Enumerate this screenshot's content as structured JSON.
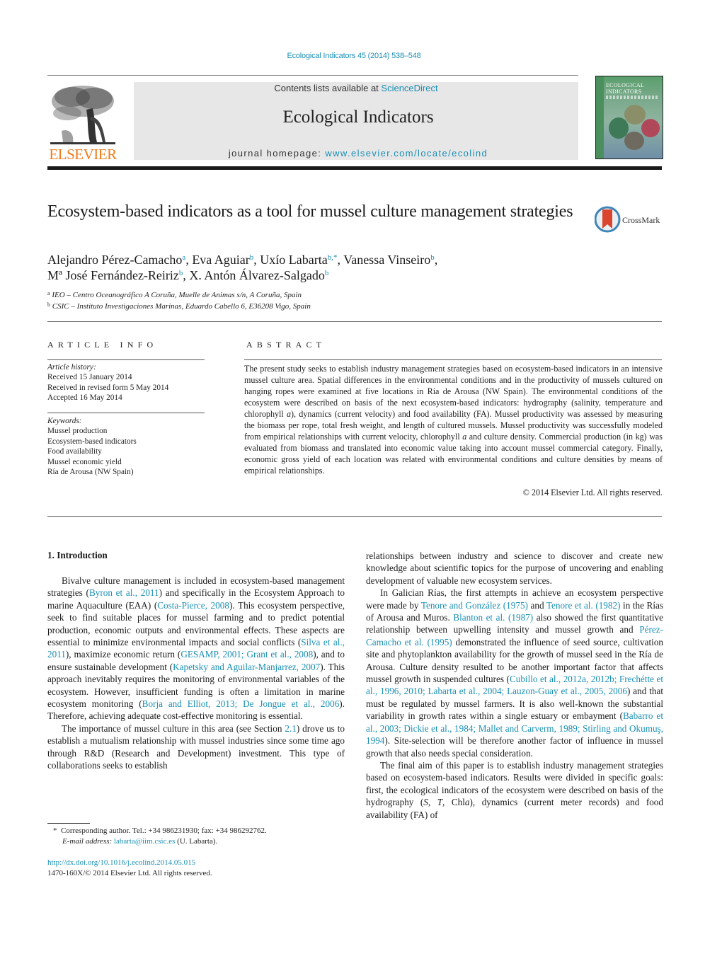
{
  "header": {
    "citation": "Ecological Indicators 45 (2014) 538–548",
    "contents_prefix": "Contents lists available at ",
    "contents_link": "ScienceDirect",
    "journal_title": "Ecological Indicators",
    "homepage_prefix": "journal homepage: ",
    "homepage_link": "www.elsevier.com/locate/ecolind",
    "publisher_logo_text": "ELSEVIER",
    "cover_title_line1": "ECOLOGICAL",
    "cover_title_line2": "INDICATORS",
    "crossmark_label": "CrossMark"
  },
  "colors": {
    "link": "#1a8fb4",
    "elsevier_orange": "#f07a1a",
    "header_box": "#e7e7e7",
    "crossmark_red": "#d9452f",
    "crossmark_ring": "#3f86b8"
  },
  "article": {
    "title": "Ecosystem-based indicators as a tool for mussel culture management strategies",
    "authors": [
      {
        "name": "Alejandro Pérez-Camacho",
        "aff": "a",
        "sep": ", "
      },
      {
        "name": "Eva Aguiar",
        "aff": "b",
        "sep": ", "
      },
      {
        "name": "Uxío Labarta",
        "aff": "b,*",
        "sep": ", "
      },
      {
        "name": "Vanessa Vinseiro",
        "aff": "b",
        "sep": ","
      },
      {
        "name": "Mª José Fernández-Reiriz",
        "aff": "b",
        "sep": ", "
      },
      {
        "name": "X. Antón Álvarez-Salgado",
        "aff": "b",
        "sep": ""
      }
    ],
    "affiliations": [
      {
        "key": "a",
        "text": "IEO – Centro Oceanográfico A Coruña, Muelle de Animas s/n, A Coruña, Spain"
      },
      {
        "key": "b",
        "text": "CSIC – Instituto Investigaciones Marinas, Eduardo Cabello 6, E36208 Vigo, Spain"
      }
    ]
  },
  "article_info": {
    "heading": "ARTICLE INFO",
    "history_label": "Article history:",
    "history": [
      "Received 15 January 2014",
      "Received in revised form 5 May 2014",
      "Accepted 16 May 2014"
    ],
    "keywords_label": "Keywords:",
    "keywords": [
      "Mussel production",
      "Ecosystem-based indicators",
      "Food availability",
      "Mussel economic yield",
      "Ría de Arousa (NW Spain)"
    ]
  },
  "abstract": {
    "heading": "ABSTRACT",
    "text": "The present study seeks to establish industry management strategies based on ecosystem-based indica­tors in an intensive mussel culture area. Spatial differences in the environmental conditions and in the productivity of mussels cultured on hanging ropes were examined at five locations in Ría de Arousa (NW Spain). The environmental conditions of the ecosystem were described on basis of the next ecosystem-based indicators: hydrography (salinity, temperature and chlorophyll a), dynamics (current velocity) and food availability (FA). Mussel productivity was assessed by measuring the biomass per rope, total fresh weight, and length of cultured mussels. Mussel productivity was successfully modeled from empirical relationships with current velocity, chlorophyll a and culture density. Commercial production (in kg) was evaluated from biomass and translated into economic value taking into account mussel commercial category. Finally, economic gross yield of each location was related with environmental conditions and culture densities by means of empirical relationships.",
    "copyright": "© 2014 Elsevier Ltd. All rights reserved."
  },
  "body": {
    "section_heading": "1.  Introduction",
    "left_paragraphs": [
      [
        {
          "t": "Bivalve culture management is included in ecosystem-based management strategies ("
        },
        {
          "l": "Byron et al., 2011"
        },
        {
          "t": ") and specifically in the Ecosystem Approach to marine Aquaculture (EAA) ("
        },
        {
          "l": "Costa-Pierce, 2008"
        },
        {
          "t": "). This ecosystem perspective, seek to find suitable places for mussel farming and to predict potential production, economic outputs and environmental effects. These aspects are essential to minimize environmental impacts and social conflicts ("
        },
        {
          "l": "Silva et al., 2011"
        },
        {
          "t": "), maximize economic return ("
        },
        {
          "l": "GESAMP, 2001; Grant et al., 2008"
        },
        {
          "t": "), and to ensure sustainable development ("
        },
        {
          "l": "Kapetsky and Aguilar-Manjarrez, 2007"
        },
        {
          "t": "). This approach inevitably requires the monitoring of environmental variables of the ecosystem. However, insufficient funding is often a limitation in marine ecosystem mon­itoring ("
        },
        {
          "l": "Borja and Elliot, 2013; De Jongue et al., 2006"
        },
        {
          "t": "). Therefore, achieving adequate cost-effective monitoring is essential."
        }
      ],
      [
        {
          "t": "The importance of mussel culture in this area (see Section "
        },
        {
          "l": "2.1"
        },
        {
          "t": ") drove us to establish a mutualism relationship with mussel industries since some time ago through R&D (Research and Devel­opment) investment. This type of collaborations seeks to establish"
        }
      ]
    ],
    "right_paragraphs": [
      [
        {
          "t": "relationships between industry and science to discover and create new knowledge about scientific topics for the purpose of uncover­ing and enabling development of valuable new ecosystem services."
        }
      ],
      [
        {
          "t": "In Galician Rías, the first attempts in achieve an ecosystem per­spective were made by "
        },
        {
          "l": "Tenore and González (1975)"
        },
        {
          "t": " and "
        },
        {
          "l": "Tenore et al. (1982)"
        },
        {
          "t": " in the Rías of Arousa and Muros. "
        },
        {
          "l": "Blanton et al. (1987)"
        },
        {
          "t": " also showed the first quantitative relationship between upwelling intensity and mussel growth and "
        },
        {
          "l": "Pérez-Camacho et al. (1995)"
        },
        {
          "t": " demonstrated the influence of seed source, cultivation site and phy­toplankton availability for the growth of mussel seed in the Ría de Arousa. Culture density resulted to be another important factor that affects mussel growth in suspended cultures ("
        },
        {
          "l": "Cubillo et al., 2012a, 2012b; Frechétte et al., 1996, 2010; Labarta et al., 2004; Lauzon-Guay et al., 2005, 2006"
        },
        {
          "t": ") and that must be regulated by mussel farmers. It is also well-known the substantial variability in growth rates within a single estuary or embayment ("
        },
        {
          "l": "Babarro et al., 2003; Dickie et al., 1984; Mallet and Carverm, 1989; Stirling and Okumuş, 1994"
        },
        {
          "t": "). Site-selection will be therefore another factor of influence in mussel growth that also needs special consideration."
        }
      ],
      [
        {
          "t": "The final aim of this paper is to establish industry manage­ment strategies based on ecosystem-based indicators. Results were divided in specific goals: first, the ecological indicators of the ecosystem were described on basis of the hydrography ("
        },
        {
          "i": "S"
        },
        {
          "t": ", "
        },
        {
          "i": "T"
        },
        {
          "t": ", Chl"
        },
        {
          "i": "a"
        },
        {
          "t": "), dynamics (current meter records) and food availability (FA) of"
        }
      ]
    ]
  },
  "footnote": {
    "marker": "*",
    "corresponding": "Corresponding author. Tel.: +34 986231930; fax: +34 986292762.",
    "email_label": "E-mail address:",
    "email": "labarta@iim.csic.es",
    "email_suffix": " (U. Labarta)."
  },
  "doi": {
    "link": "http://dx.doi.org/10.1016/j.ecolind.2014.05.015",
    "issn_line": "1470-160X/© 2014 Elsevier Ltd. All rights reserved."
  }
}
